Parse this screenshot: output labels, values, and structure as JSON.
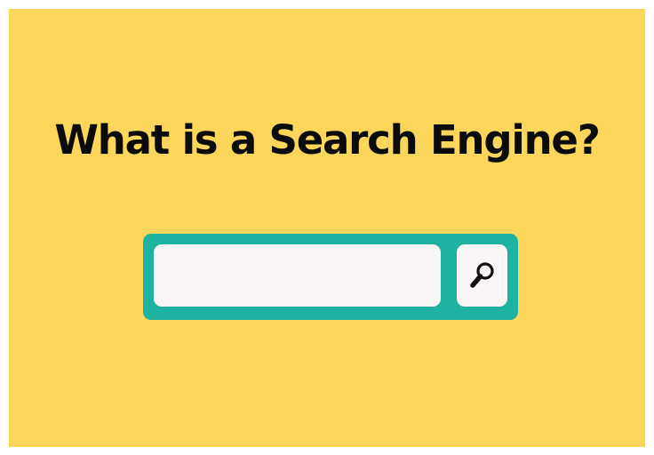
{
  "headline": "What is a Search Engine?",
  "search": {
    "value": "",
    "placeholder": ""
  },
  "search_button": {
    "icon": "magnifying-glass-icon"
  },
  "colors": {
    "background": "#fbd65a",
    "search_frame": "#1db3a0",
    "field": "#fbf5f5",
    "text": "#0b0b0b"
  }
}
